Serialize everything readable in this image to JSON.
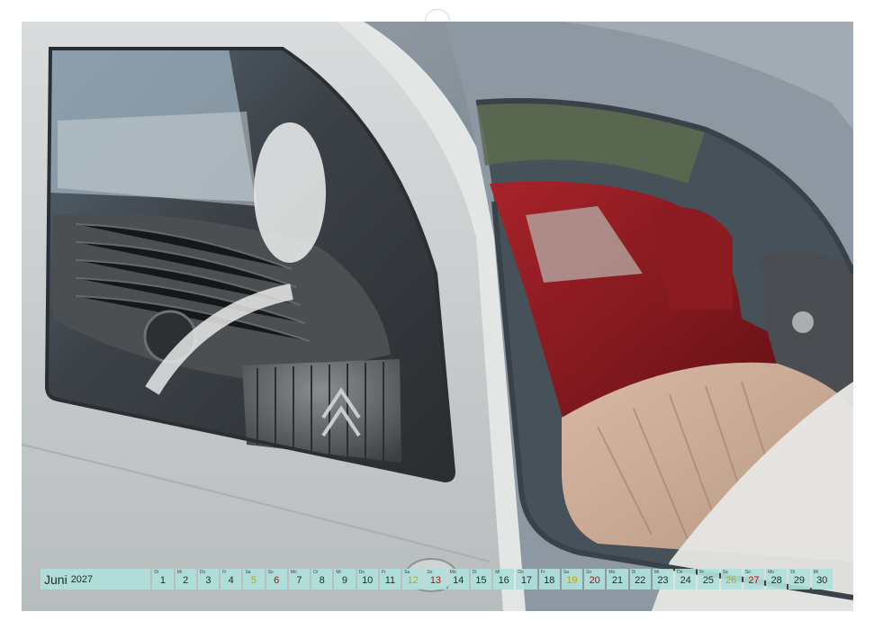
{
  "calendar": {
    "month": "Juni",
    "year": "2027",
    "days": [
      {
        "wd": "Di",
        "num": "1",
        "type": "weekday"
      },
      {
        "wd": "Mi",
        "num": "2",
        "type": "weekday"
      },
      {
        "wd": "Do",
        "num": "3",
        "type": "weekday"
      },
      {
        "wd": "Fr",
        "num": "4",
        "type": "weekday"
      },
      {
        "wd": "Sa",
        "num": "5",
        "type": "sat"
      },
      {
        "wd": "So",
        "num": "6",
        "type": "sun"
      },
      {
        "wd": "Mo",
        "num": "7",
        "type": "weekday"
      },
      {
        "wd": "Di",
        "num": "8",
        "type": "weekday"
      },
      {
        "wd": "Mi",
        "num": "9",
        "type": "weekday"
      },
      {
        "wd": "Do",
        "num": "10",
        "type": "weekday"
      },
      {
        "wd": "Fr",
        "num": "11",
        "type": "weekday"
      },
      {
        "wd": "Sa",
        "num": "12",
        "type": "sat"
      },
      {
        "wd": "So",
        "num": "13",
        "type": "sun"
      },
      {
        "wd": "Mo",
        "num": "14",
        "type": "weekday"
      },
      {
        "wd": "Di",
        "num": "15",
        "type": "weekday"
      },
      {
        "wd": "Mi",
        "num": "16",
        "type": "weekday"
      },
      {
        "wd": "Do",
        "num": "17",
        "type": "weekday"
      },
      {
        "wd": "Fr",
        "num": "18",
        "type": "weekday"
      },
      {
        "wd": "Sa",
        "num": "19",
        "type": "sat"
      },
      {
        "wd": "So",
        "num": "20",
        "type": "sun"
      },
      {
        "wd": "Mo",
        "num": "21",
        "type": "weekday"
      },
      {
        "wd": "Di",
        "num": "22",
        "type": "weekday"
      },
      {
        "wd": "Mi",
        "num": "23",
        "type": "weekday"
      },
      {
        "wd": "Do",
        "num": "24",
        "type": "weekday"
      },
      {
        "wd": "Fr",
        "num": "25",
        "type": "weekday"
      },
      {
        "wd": "Sa",
        "num": "26",
        "type": "sat"
      },
      {
        "wd": "So",
        "num": "27",
        "type": "sun"
      },
      {
        "wd": "Mo",
        "num": "28",
        "type": "weekday"
      },
      {
        "wd": "Di",
        "num": "29",
        "type": "weekday"
      },
      {
        "wd": "Mi",
        "num": "30",
        "type": "weekday"
      }
    ]
  },
  "colors": {
    "bar": "#b0e0da",
    "saturday": "#c8a200",
    "sunday": "#d10000"
  }
}
